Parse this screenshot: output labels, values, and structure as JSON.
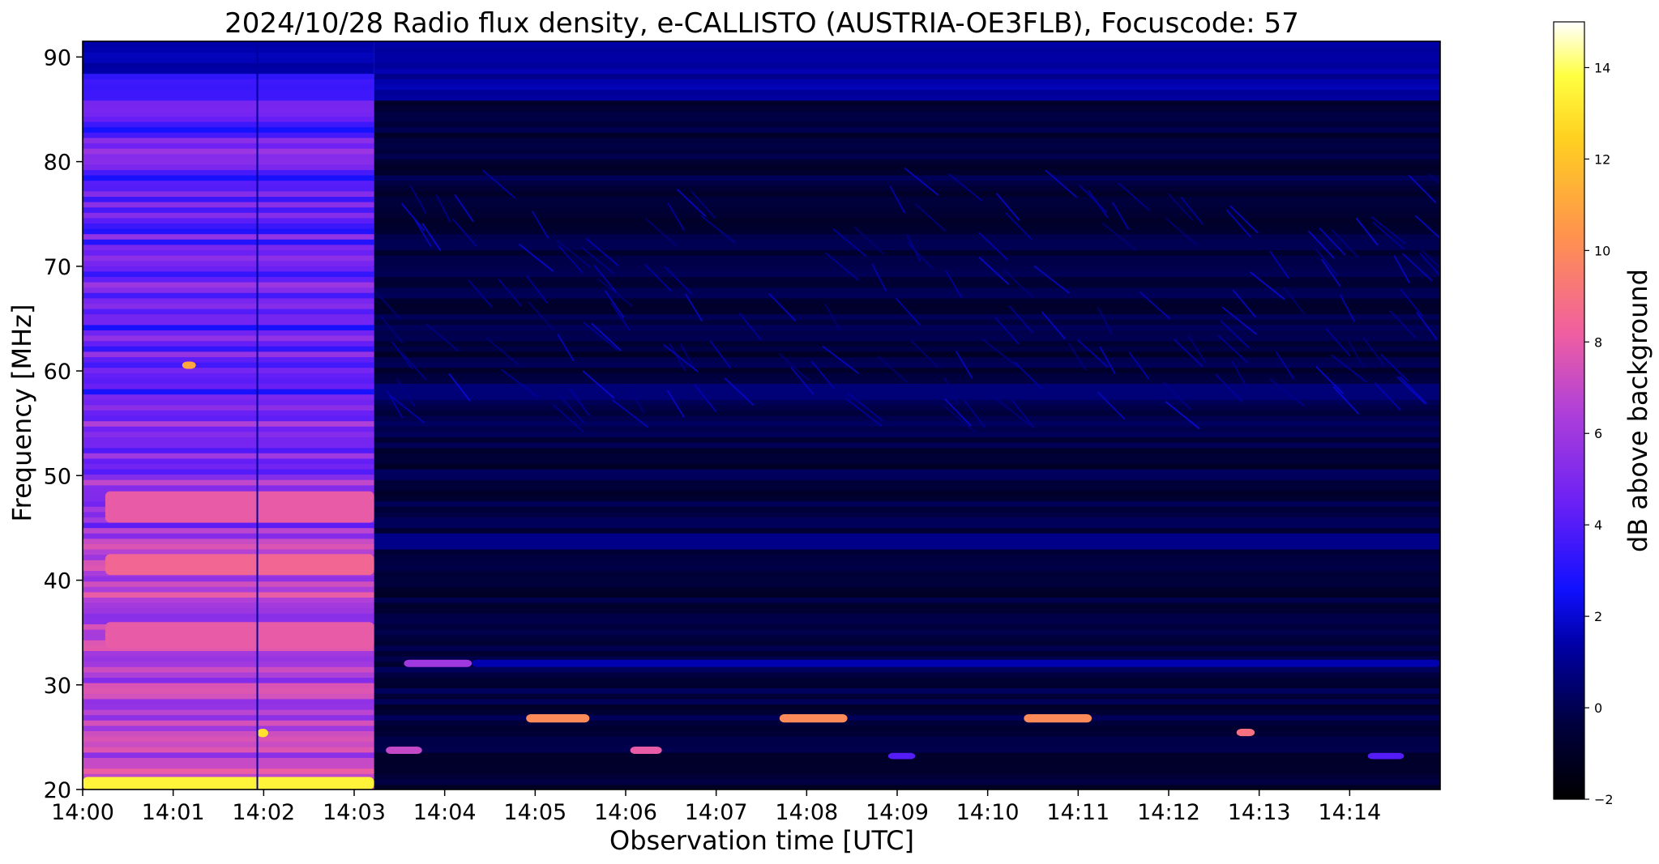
{
  "chart_data": {
    "type": "heatmap",
    "title": "2024/10/28  Radio flux density, e-CALLISTO (AUSTRIA-OE3FLB), Focuscode: 57",
    "xlabel": "Observation time [UTC]",
    "ylabel": "Frequency [MHz]",
    "colorbar_label": "dB above background",
    "xlim": [
      0,
      15
    ],
    "ylim": [
      20,
      91.5
    ],
    "x_ticks": [
      {
        "value": 0,
        "label": "14:00"
      },
      {
        "value": 1,
        "label": "14:01"
      },
      {
        "value": 2,
        "label": "14:02"
      },
      {
        "value": 3,
        "label": "14:03"
      },
      {
        "value": 4,
        "label": "14:04"
      },
      {
        "value": 5,
        "label": "14:05"
      },
      {
        "value": 6,
        "label": "14:06"
      },
      {
        "value": 7,
        "label": "14:07"
      },
      {
        "value": 8,
        "label": "14:08"
      },
      {
        "value": 9,
        "label": "14:09"
      },
      {
        "value": 10,
        "label": "14:10"
      },
      {
        "value": 11,
        "label": "14:11"
      },
      {
        "value": 12,
        "label": "14:12"
      },
      {
        "value": 13,
        "label": "14:13"
      },
      {
        "value": 14,
        "label": "14:14"
      }
    ],
    "y_ticks": [
      {
        "value": 20,
        "label": "20"
      },
      {
        "value": 30,
        "label": "30"
      },
      {
        "value": 40,
        "label": "40"
      },
      {
        "value": 50,
        "label": "50"
      },
      {
        "value": 60,
        "label": "60"
      },
      {
        "value": 70,
        "label": "70"
      },
      {
        "value": 80,
        "label": "80"
      },
      {
        "value": 90,
        "label": "90"
      }
    ],
    "colorbar": {
      "range": [
        -2,
        15
      ],
      "ticks": [
        {
          "value": -2,
          "label": "−2"
        },
        {
          "value": 0,
          "label": "0"
        },
        {
          "value": 2,
          "label": "2"
        },
        {
          "value": 4,
          "label": "4"
        },
        {
          "value": 6,
          "label": "6"
        },
        {
          "value": 8,
          "label": "8"
        },
        {
          "value": 10,
          "label": "10"
        },
        {
          "value": 12,
          "label": "12"
        },
        {
          "value": 14,
          "label": "14"
        }
      ],
      "colormap": "gnuplot2"
    },
    "regions": [
      {
        "t_start": 0.0,
        "t_end": 3.22,
        "level_db": 5.5,
        "description": "elevated broadband background (~5-8 dB)"
      },
      {
        "t_start": 3.22,
        "t_end": 15.0,
        "level_db": -1.0,
        "description": "quiet background with drifting interference streaks 55-78 MHz"
      }
    ],
    "features": [
      {
        "t_start": 0.0,
        "t_end": 3.22,
        "f_low": 20.0,
        "f_high": 21.2,
        "db": 13.5
      },
      {
        "t_start": 0.25,
        "t_end": 3.22,
        "f_low": 45.5,
        "f_high": 48.5,
        "db": 8.0
      },
      {
        "t_start": 0.25,
        "t_end": 3.22,
        "f_low": 40.5,
        "f_high": 42.5,
        "db": 8.5
      },
      {
        "t_start": 0.25,
        "t_end": 3.22,
        "f_low": 33.5,
        "f_high": 36.0,
        "db": 8.0
      },
      {
        "t_start": 1.93,
        "t_end": 2.05,
        "f_low": 25.0,
        "f_high": 25.8,
        "db": 13.0
      },
      {
        "t_start": 1.1,
        "t_end": 1.25,
        "f_low": 60.2,
        "f_high": 60.9,
        "db": 11.0
      },
      {
        "t_start": 3.55,
        "t_end": 4.3,
        "f_low": 31.7,
        "f_high": 32.4,
        "db": 6.0
      },
      {
        "t_start": 4.3,
        "t_end": 15.0,
        "f_low": 31.7,
        "f_high": 32.4,
        "db": 1.5
      },
      {
        "t_start": 4.9,
        "t_end": 5.6,
        "f_low": 26.4,
        "f_high": 27.2,
        "db": 10.0
      },
      {
        "t_start": 7.7,
        "t_end": 8.45,
        "f_low": 26.4,
        "f_high": 27.2,
        "db": 10.0
      },
      {
        "t_start": 10.4,
        "t_end": 11.15,
        "f_low": 26.4,
        "f_high": 27.2,
        "db": 10.0
      },
      {
        "t_start": 12.75,
        "t_end": 12.95,
        "f_low": 25.1,
        "f_high": 25.8,
        "db": 9.0
      },
      {
        "t_start": 3.35,
        "t_end": 3.75,
        "f_low": 23.4,
        "f_high": 24.1,
        "db": 7.0
      },
      {
        "t_start": 6.05,
        "t_end": 6.4,
        "f_low": 23.4,
        "f_high": 24.1,
        "db": 8.0
      },
      {
        "t_start": 14.2,
        "t_end": 14.6,
        "f_low": 22.9,
        "f_high": 23.5,
        "db": 4.0
      },
      {
        "t_start": 8.9,
        "t_end": 9.2,
        "f_low": 22.9,
        "f_high": 23.5,
        "db": 4.0
      }
    ]
  }
}
